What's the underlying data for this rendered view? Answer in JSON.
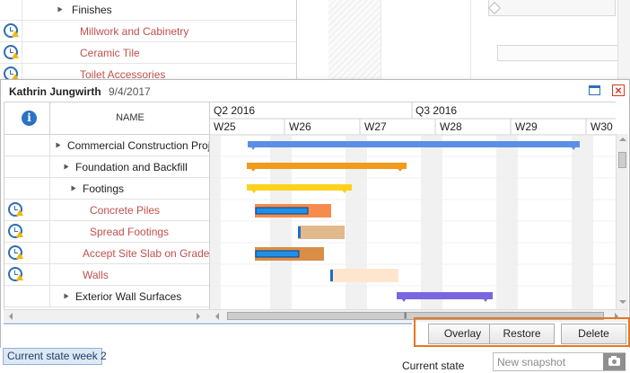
{
  "background": {
    "rows": [
      {
        "name": "Finishes",
        "color": "dark",
        "has_icon": false,
        "expander": true
      },
      {
        "name": "Millwork and Cabinetry",
        "color": "red",
        "has_icon": true
      },
      {
        "name": "Ceramic Tile",
        "color": "red",
        "has_icon": true
      },
      {
        "name": "Toilet Accessories",
        "color": "red",
        "has_icon": true
      }
    ]
  },
  "popup": {
    "user": "Kathrin Jungwirth",
    "date": "9/4/2017",
    "grid": {
      "name_header": "NAME",
      "rows": [
        {
          "name": "Commercial Construction Proj...",
          "color": "dark",
          "has_icon": false,
          "level": 0,
          "expander": true
        },
        {
          "name": "Foundation and Backfill",
          "color": "dark",
          "has_icon": false,
          "level": 1,
          "expander": true
        },
        {
          "name": "Footings",
          "color": "dark",
          "has_icon": false,
          "level": 2,
          "expander": true
        },
        {
          "name": "Concrete Piles",
          "color": "red",
          "has_icon": true,
          "level": 3
        },
        {
          "name": "Spread Footings",
          "color": "red",
          "has_icon": true,
          "level": 3
        },
        {
          "name": "Accept Site Slab on Grade",
          "color": "red",
          "has_icon": true,
          "level": 2
        },
        {
          "name": "Walls",
          "color": "red",
          "has_icon": true,
          "level": 2
        },
        {
          "name": "Exterior Wall Surfaces",
          "color": "dark",
          "has_icon": false,
          "level": 1,
          "expander": true
        }
      ]
    },
    "timeline": {
      "quarters": [
        "Q2 2016",
        "Q3 2016"
      ],
      "weeks": [
        "W25",
        "W26",
        "W27",
        "W28",
        "W29",
        "W30"
      ]
    },
    "buttons": {
      "overlay": "Overlay",
      "restore": "Restore",
      "delete": "Delete"
    },
    "accent_color": "#e87722"
  },
  "status": {
    "state_tab": "Current state week 2",
    "current_state": "Current state",
    "snapshot_placeholder": "New snapshot"
  },
  "colors": {
    "summary_blue": "#5b8fe6",
    "summary_orange": "#f29a1b",
    "summary_yellow": "#fcd21c",
    "task_orange": "#f58b4c",
    "task_tan": "#e2b98b",
    "task_brown": "#d98d46",
    "task_peach": "#fde6cd",
    "summary_purple": "#7b66e0",
    "progress_blue": "#1e90e8",
    "task_name_red": "#c0504d"
  }
}
